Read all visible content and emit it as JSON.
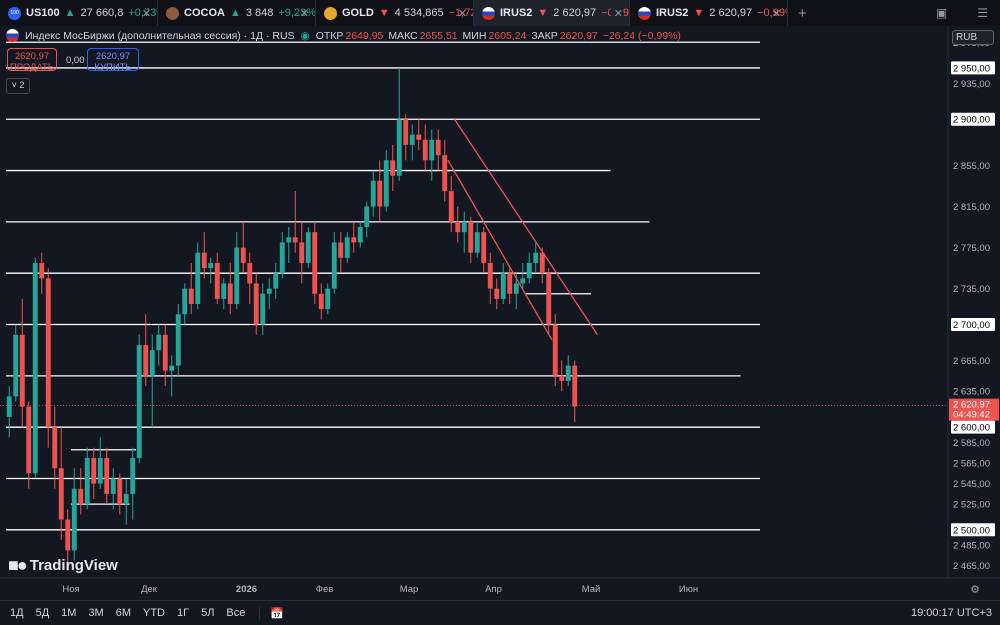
{
  "tabs": [
    {
      "symbol": "US100",
      "arrow": "▲",
      "price": "27 660,8",
      "change": "+0,73%",
      "dir": "up",
      "icon": "nasdaq-badge-icon",
      "icon_text": "100",
      "icon_color": "#2962ff"
    },
    {
      "symbol": "COCOA",
      "arrow": "▲",
      "price": "3 848",
      "change": "+9,23%",
      "dir": "up",
      "icon": "cocoa-bean-icon",
      "icon_color": "#8d5a3b"
    },
    {
      "symbol": "GOLD",
      "arrow": "▼",
      "price": "4 534,865",
      "change": "−1,72%",
      "dir": "dn",
      "icon": "gold-coin-icon",
      "icon_color": "#e0a82e"
    },
    {
      "symbol": "IRUS2",
      "arrow": "▼",
      "price": "2 620,97",
      "change": "−0,99%",
      "dir": "dn",
      "icon": "russia-flag-icon",
      "active": true
    },
    {
      "symbol": "IRUS2",
      "arrow": "▼",
      "price": "2 620,97",
      "change": "−0,99%",
      "dir": "dn",
      "icon": "russia-flag-icon"
    }
  ],
  "toolbar": {
    "add_tab": "+",
    "layout_icon": "layout-icon",
    "menu_icon": "more-icon"
  },
  "legend": {
    "title": "Индекс МосБиржи (дополнительная сессия) · 1Д · RUS",
    "open_label": "ОТКР",
    "open": "2649,95",
    "high_label": "МАКС",
    "high": "2655,51",
    "low_label": "МИН",
    "low": "2605,24",
    "close_label": "ЗАКР",
    "close": "2620,97",
    "change": "−26,24 (−0,99%)"
  },
  "currency": "RUB",
  "trade": {
    "sell_price": "2620,97",
    "sell_label": "ПРОДАТЬ",
    "spread": "0,00",
    "buy_price": "2620,97",
    "buy_label": "КУПИТЬ"
  },
  "collapse_count": "2",
  "watermark": "TradingView",
  "colors": {
    "bg": "#131722",
    "up": "#26a69a",
    "down": "#ef5350",
    "level": "#ffffff",
    "channel": "#ef5350",
    "grid": "#1f2330"
  },
  "chart_data": {
    "type": "candlestick",
    "ylim": [
      2455,
      2985
    ],
    "y_ticks": [
      "2 975,00",
      "2 950,00",
      "2 935,00",
      "2 900,00",
      "2 855,00",
      "2 815,00",
      "2 775,00",
      "2 735,00",
      "2 700,00",
      "2 665,00",
      "2 635,00",
      "2 600,00",
      "2 585,00",
      "2 565,00",
      "2 545,00",
      "2 525,00",
      "2 500,00",
      "2 485,00",
      "2 465,00"
    ],
    "boxed_ticks": [
      "2 950,00",
      "2 900,00",
      "2 700,00",
      "2 600,00",
      "2 500,00"
    ],
    "x_labels": [
      {
        "label": "Ноя",
        "bar": 10,
        "bold": false
      },
      {
        "label": "Дек",
        "bar": 22,
        "bold": false
      },
      {
        "label": "2026",
        "bar": 37,
        "bold": true
      },
      {
        "label": "Фев",
        "bar": 49,
        "bold": false
      },
      {
        "label": "Мар",
        "bar": 62,
        "bold": false
      },
      {
        "label": "Апр",
        "bar": 75,
        "bold": false
      },
      {
        "label": "Май",
        "bar": 90,
        "bold": false
      },
      {
        "label": "Июн",
        "bar": 105,
        "bold": false
      }
    ],
    "last_price": {
      "value": 2620.97,
      "label": "2 620,97",
      "countdown": "04:49:42"
    },
    "levels": [
      {
        "value": 2975,
        "from_bar": 0,
        "to_bar": 116
      },
      {
        "value": 2950,
        "from_bar": 0,
        "to_bar": 116
      },
      {
        "value": 2900,
        "from_bar": 0,
        "to_bar": 116
      },
      {
        "value": 2850,
        "from_bar": 0,
        "to_bar": 93
      },
      {
        "value": 2800,
        "from_bar": 0,
        "to_bar": 99
      },
      {
        "value": 2750,
        "from_bar": 0,
        "to_bar": 116
      },
      {
        "value": 2700,
        "from_bar": 0,
        "to_bar": 116
      },
      {
        "value": 2650,
        "from_bar": 0,
        "to_bar": 113
      },
      {
        "value": 2600,
        "from_bar": 0,
        "to_bar": 116
      },
      {
        "value": 2550,
        "from_bar": 0,
        "to_bar": 116
      },
      {
        "value": 2500,
        "from_bar": 0,
        "to_bar": 116
      },
      {
        "value": 2578,
        "from_bar": 10,
        "to_bar": 20
      },
      {
        "value": 2525,
        "from_bar": 10,
        "to_bar": 19
      },
      {
        "value": 2730,
        "from_bar": 80,
        "to_bar": 90
      }
    ],
    "channel": [
      {
        "x1_bar": 69,
        "y1": 2900,
        "x2_bar": 91,
        "y2": 2690
      },
      {
        "x1_bar": 68,
        "y1": 2860,
        "x2_bar": 84,
        "y2": 2685
      }
    ],
    "candles": [
      [
        2610,
        2640,
        2590,
        2630
      ],
      [
        2630,
        2700,
        2625,
        2690
      ],
      [
        2690,
        2725,
        2600,
        2620
      ],
      [
        2620,
        2625,
        2540,
        2555
      ],
      [
        2555,
        2765,
        2550,
        2760
      ],
      [
        2760,
        2770,
        2730,
        2745
      ],
      [
        2745,
        2755,
        2580,
        2600
      ],
      [
        2600,
        2620,
        2540,
        2560
      ],
      [
        2560,
        2600,
        2490,
        2510
      ],
      [
        2510,
        2520,
        2460,
        2480
      ],
      [
        2480,
        2560,
        2470,
        2540
      ],
      [
        2540,
        2560,
        2515,
        2525
      ],
      [
        2525,
        2580,
        2520,
        2570
      ],
      [
        2570,
        2580,
        2530,
        2545
      ],
      [
        2545,
        2590,
        2540,
        2570
      ],
      [
        2570,
        2580,
        2525,
        2535
      ],
      [
        2535,
        2560,
        2520,
        2550
      ],
      [
        2550,
        2555,
        2515,
        2525
      ],
      [
        2525,
        2550,
        2505,
        2535
      ],
      [
        2535,
        2580,
        2510,
        2570
      ],
      [
        2570,
        2690,
        2565,
        2680
      ],
      [
        2680,
        2710,
        2640,
        2650
      ],
      [
        2650,
        2690,
        2600,
        2675
      ],
      [
        2675,
        2700,
        2660,
        2690
      ],
      [
        2690,
        2700,
        2640,
        2655
      ],
      [
        2655,
        2670,
        2630,
        2660
      ],
      [
        2660,
        2720,
        2650,
        2710
      ],
      [
        2710,
        2740,
        2700,
        2735
      ],
      [
        2735,
        2760,
        2710,
        2720
      ],
      [
        2720,
        2780,
        2715,
        2770
      ],
      [
        2770,
        2790,
        2745,
        2755
      ],
      [
        2755,
        2765,
        2740,
        2760
      ],
      [
        2760,
        2770,
        2720,
        2725
      ],
      [
        2725,
        2745,
        2715,
        2740
      ],
      [
        2740,
        2760,
        2710,
        2720
      ],
      [
        2720,
        2790,
        2715,
        2775
      ],
      [
        2775,
        2800,
        2750,
        2760
      ],
      [
        2760,
        2770,
        2720,
        2740
      ],
      [
        2740,
        2750,
        2690,
        2700
      ],
      [
        2700,
        2740,
        2690,
        2730
      ],
      [
        2730,
        2745,
        2715,
        2735
      ],
      [
        2735,
        2760,
        2725,
        2750
      ],
      [
        2750,
        2790,
        2745,
        2780
      ],
      [
        2780,
        2795,
        2760,
        2785
      ],
      [
        2785,
        2830,
        2770,
        2780
      ],
      [
        2780,
        2800,
        2740,
        2760
      ],
      [
        2760,
        2795,
        2755,
        2790
      ],
      [
        2790,
        2800,
        2720,
        2730
      ],
      [
        2730,
        2740,
        2705,
        2715
      ],
      [
        2715,
        2740,
        2710,
        2735
      ],
      [
        2735,
        2790,
        2730,
        2780
      ],
      [
        2780,
        2790,
        2750,
        2765
      ],
      [
        2765,
        2790,
        2760,
        2785
      ],
      [
        2785,
        2800,
        2770,
        2780
      ],
      [
        2780,
        2800,
        2775,
        2795
      ],
      [
        2795,
        2820,
        2785,
        2815
      ],
      [
        2815,
        2850,
        2805,
        2840
      ],
      [
        2840,
        2860,
        2800,
        2815
      ],
      [
        2815,
        2870,
        2810,
        2860
      ],
      [
        2860,
        2875,
        2830,
        2845
      ],
      [
        2845,
        2950,
        2840,
        2900
      ],
      [
        2900,
        2905,
        2860,
        2875
      ],
      [
        2875,
        2895,
        2860,
        2885
      ],
      [
        2885,
        2900,
        2870,
        2880
      ],
      [
        2880,
        2895,
        2850,
        2860
      ],
      [
        2860,
        2890,
        2840,
        2880
      ],
      [
        2880,
        2890,
        2850,
        2865
      ],
      [
        2865,
        2880,
        2820,
        2830
      ],
      [
        2830,
        2845,
        2790,
        2800
      ],
      [
        2800,
        2815,
        2780,
        2790
      ],
      [
        2790,
        2810,
        2770,
        2800
      ],
      [
        2800,
        2805,
        2760,
        2770
      ],
      [
        2770,
        2800,
        2765,
        2790
      ],
      [
        2790,
        2795,
        2750,
        2760
      ],
      [
        2760,
        2770,
        2720,
        2735
      ],
      [
        2735,
        2745,
        2715,
        2725
      ],
      [
        2725,
        2760,
        2720,
        2750
      ],
      [
        2750,
        2755,
        2720,
        2730
      ],
      [
        2730,
        2750,
        2715,
        2740
      ],
      [
        2740,
        2760,
        2735,
        2745
      ],
      [
        2745,
        2770,
        2740,
        2760
      ],
      [
        2760,
        2780,
        2750,
        2770
      ],
      [
        2770,
        2775,
        2740,
        2750
      ],
      [
        2750,
        2755,
        2690,
        2700
      ],
      [
        2700,
        2710,
        2640,
        2650
      ],
      [
        2650,
        2665,
        2635,
        2645
      ],
      [
        2645,
        2670,
        2640,
        2660
      ],
      [
        2660,
        2665,
        2605,
        2620
      ]
    ]
  }
}
